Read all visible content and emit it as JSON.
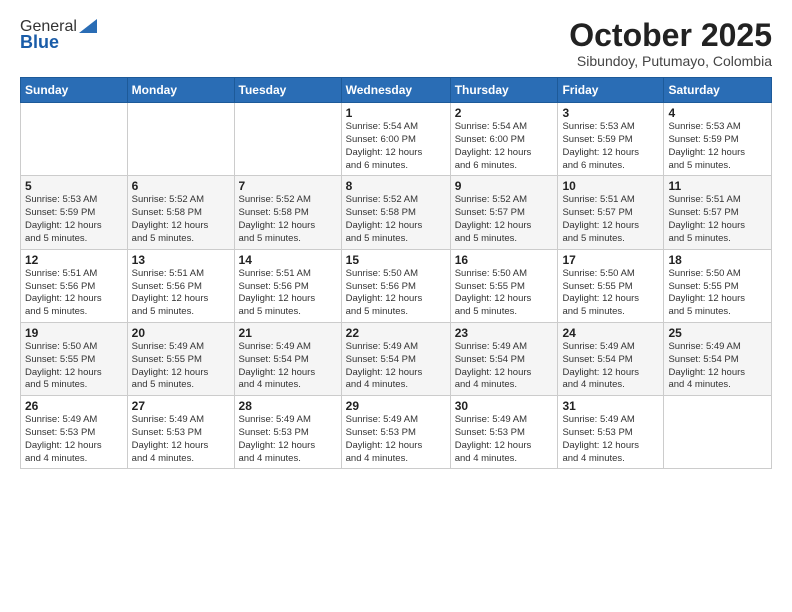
{
  "logo": {
    "general": "General",
    "blue": "Blue"
  },
  "header": {
    "month": "October 2025",
    "location": "Sibundoy, Putumayo, Colombia"
  },
  "weekdays": [
    "Sunday",
    "Monday",
    "Tuesday",
    "Wednesday",
    "Thursday",
    "Friday",
    "Saturday"
  ],
  "weeks": [
    [
      {
        "day": "",
        "info": ""
      },
      {
        "day": "",
        "info": ""
      },
      {
        "day": "",
        "info": ""
      },
      {
        "day": "1",
        "info": "Sunrise: 5:54 AM\nSunset: 6:00 PM\nDaylight: 12 hours\nand 6 minutes."
      },
      {
        "day": "2",
        "info": "Sunrise: 5:54 AM\nSunset: 6:00 PM\nDaylight: 12 hours\nand 6 minutes."
      },
      {
        "day": "3",
        "info": "Sunrise: 5:53 AM\nSunset: 5:59 PM\nDaylight: 12 hours\nand 6 minutes."
      },
      {
        "day": "4",
        "info": "Sunrise: 5:53 AM\nSunset: 5:59 PM\nDaylight: 12 hours\nand 5 minutes."
      }
    ],
    [
      {
        "day": "5",
        "info": "Sunrise: 5:53 AM\nSunset: 5:59 PM\nDaylight: 12 hours\nand 5 minutes."
      },
      {
        "day": "6",
        "info": "Sunrise: 5:52 AM\nSunset: 5:58 PM\nDaylight: 12 hours\nand 5 minutes."
      },
      {
        "day": "7",
        "info": "Sunrise: 5:52 AM\nSunset: 5:58 PM\nDaylight: 12 hours\nand 5 minutes."
      },
      {
        "day": "8",
        "info": "Sunrise: 5:52 AM\nSunset: 5:58 PM\nDaylight: 12 hours\nand 5 minutes."
      },
      {
        "day": "9",
        "info": "Sunrise: 5:52 AM\nSunset: 5:57 PM\nDaylight: 12 hours\nand 5 minutes."
      },
      {
        "day": "10",
        "info": "Sunrise: 5:51 AM\nSunset: 5:57 PM\nDaylight: 12 hours\nand 5 minutes."
      },
      {
        "day": "11",
        "info": "Sunrise: 5:51 AM\nSunset: 5:57 PM\nDaylight: 12 hours\nand 5 minutes."
      }
    ],
    [
      {
        "day": "12",
        "info": "Sunrise: 5:51 AM\nSunset: 5:56 PM\nDaylight: 12 hours\nand 5 minutes."
      },
      {
        "day": "13",
        "info": "Sunrise: 5:51 AM\nSunset: 5:56 PM\nDaylight: 12 hours\nand 5 minutes."
      },
      {
        "day": "14",
        "info": "Sunrise: 5:51 AM\nSunset: 5:56 PM\nDaylight: 12 hours\nand 5 minutes."
      },
      {
        "day": "15",
        "info": "Sunrise: 5:50 AM\nSunset: 5:56 PM\nDaylight: 12 hours\nand 5 minutes."
      },
      {
        "day": "16",
        "info": "Sunrise: 5:50 AM\nSunset: 5:55 PM\nDaylight: 12 hours\nand 5 minutes."
      },
      {
        "day": "17",
        "info": "Sunrise: 5:50 AM\nSunset: 5:55 PM\nDaylight: 12 hours\nand 5 minutes."
      },
      {
        "day": "18",
        "info": "Sunrise: 5:50 AM\nSunset: 5:55 PM\nDaylight: 12 hours\nand 5 minutes."
      }
    ],
    [
      {
        "day": "19",
        "info": "Sunrise: 5:50 AM\nSunset: 5:55 PM\nDaylight: 12 hours\nand 5 minutes."
      },
      {
        "day": "20",
        "info": "Sunrise: 5:49 AM\nSunset: 5:55 PM\nDaylight: 12 hours\nand 5 minutes."
      },
      {
        "day": "21",
        "info": "Sunrise: 5:49 AM\nSunset: 5:54 PM\nDaylight: 12 hours\nand 4 minutes."
      },
      {
        "day": "22",
        "info": "Sunrise: 5:49 AM\nSunset: 5:54 PM\nDaylight: 12 hours\nand 4 minutes."
      },
      {
        "day": "23",
        "info": "Sunrise: 5:49 AM\nSunset: 5:54 PM\nDaylight: 12 hours\nand 4 minutes."
      },
      {
        "day": "24",
        "info": "Sunrise: 5:49 AM\nSunset: 5:54 PM\nDaylight: 12 hours\nand 4 minutes."
      },
      {
        "day": "25",
        "info": "Sunrise: 5:49 AM\nSunset: 5:54 PM\nDaylight: 12 hours\nand 4 minutes."
      }
    ],
    [
      {
        "day": "26",
        "info": "Sunrise: 5:49 AM\nSunset: 5:53 PM\nDaylight: 12 hours\nand 4 minutes."
      },
      {
        "day": "27",
        "info": "Sunrise: 5:49 AM\nSunset: 5:53 PM\nDaylight: 12 hours\nand 4 minutes."
      },
      {
        "day": "28",
        "info": "Sunrise: 5:49 AM\nSunset: 5:53 PM\nDaylight: 12 hours\nand 4 minutes."
      },
      {
        "day": "29",
        "info": "Sunrise: 5:49 AM\nSunset: 5:53 PM\nDaylight: 12 hours\nand 4 minutes."
      },
      {
        "day": "30",
        "info": "Sunrise: 5:49 AM\nSunset: 5:53 PM\nDaylight: 12 hours\nand 4 minutes."
      },
      {
        "day": "31",
        "info": "Sunrise: 5:49 AM\nSunset: 5:53 PM\nDaylight: 12 hours\nand 4 minutes."
      },
      {
        "day": "",
        "info": ""
      }
    ]
  ]
}
